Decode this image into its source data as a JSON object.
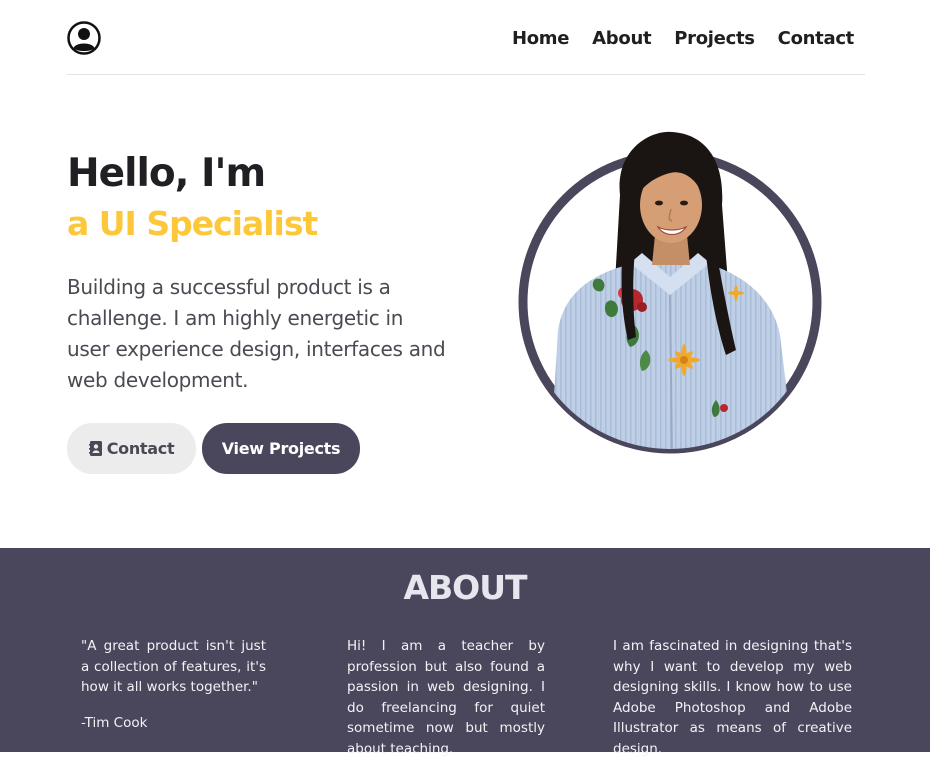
{
  "nav": {
    "items": [
      {
        "label": "Home"
      },
      {
        "label": "About"
      },
      {
        "label": "Projects"
      },
      {
        "label": "Contact"
      }
    ]
  },
  "hero": {
    "greeting": "Hello, I'm",
    "role": "a UI Specialist",
    "description": "Building a successful product is a challenge. I am highly energetic in user experience design, interfaces and web development.",
    "contact_button": "Contact",
    "projects_button": "View Projects"
  },
  "about": {
    "title": "ABOUT",
    "quote": "\"A great product isn't just a collection of features, it's how it all works together.\"",
    "quote_author": "-Tim Cook",
    "bio": "Hi! I am a teacher by profession but also found a passion in web designing. I do freelancing for quiet sometime now but mostly about teaching.",
    "skills": "I am fascinated in designing that's why I want to develop my web designing skills. I know how to use Adobe Photoshop and Adobe Illustrator as means of creative design."
  },
  "colors": {
    "accent": "#fdc73a",
    "primary": "#4a475c",
    "heading": "#1f1f24"
  },
  "icons": {
    "logo": "user-circle-icon",
    "contact": "address-book-icon"
  }
}
